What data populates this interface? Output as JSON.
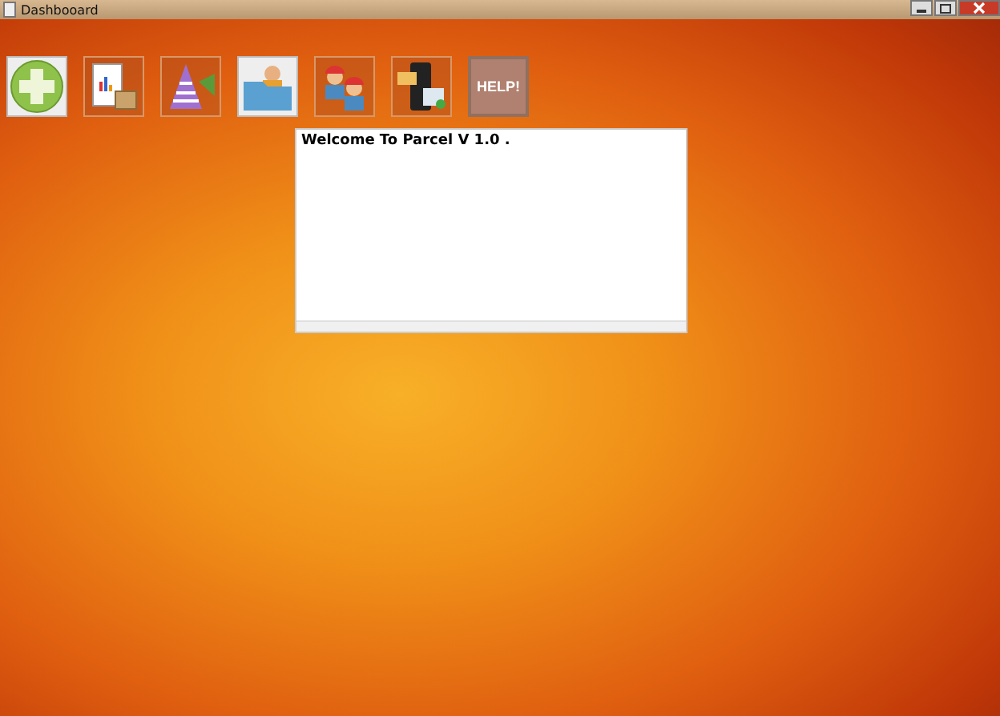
{
  "window": {
    "title": "Dashbooard"
  },
  "toolbar": {
    "buttons": [
      {
        "kind": "add"
      },
      {
        "kind": "report"
      },
      {
        "kind": "party"
      },
      {
        "kind": "folder"
      },
      {
        "kind": "workers"
      },
      {
        "kind": "sms"
      },
      {
        "kind": "help",
        "label": "HELP!"
      }
    ]
  },
  "message_box": {
    "text": "Welcome To Parcel V 1.0 ."
  }
}
